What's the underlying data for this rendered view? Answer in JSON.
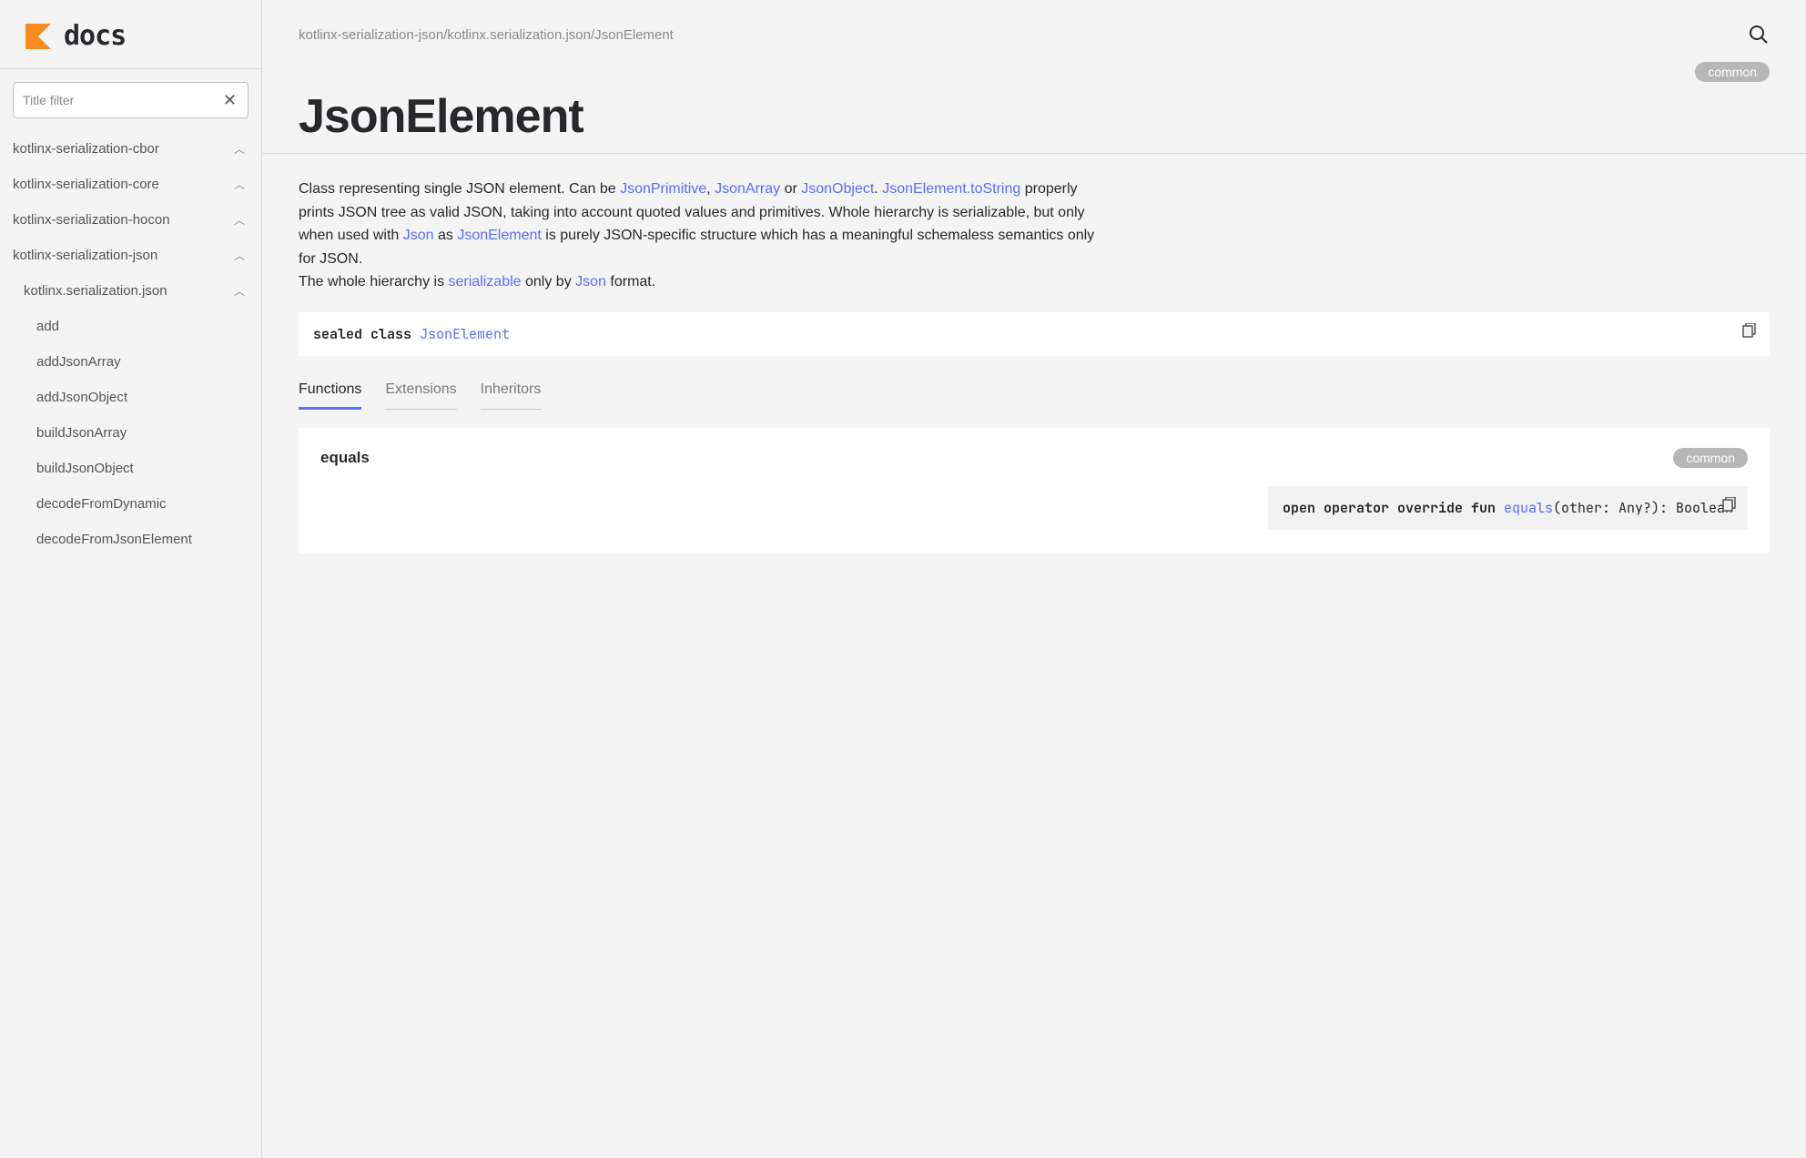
{
  "logo": {
    "text": "docs"
  },
  "filter": {
    "placeholder": "Title filter"
  },
  "nav_top": [
    {
      "label": "kotlinx-serialization-cbor"
    },
    {
      "label": "kotlinx-serialization-core"
    },
    {
      "label": "kotlinx-serialization-hocon"
    },
    {
      "label": "kotlinx-serialization-json"
    }
  ],
  "nav_sub": {
    "label": "kotlinx.serialization.json"
  },
  "nav_leaves": [
    {
      "label": "add"
    },
    {
      "label": "addJsonArray"
    },
    {
      "label": "addJsonObject"
    },
    {
      "label": "buildJsonArray"
    },
    {
      "label": "buildJsonObject"
    },
    {
      "label": "decodeFromDynamic"
    },
    {
      "label": "decodeFromJsonElement"
    }
  ],
  "breadcrumb": "kotlinx-serialization-json/kotlinx.serialization.json/JsonElement",
  "badge": "common",
  "title": "JsonElement",
  "desc": {
    "pre1": "Class representing single JSON element. Can be ",
    "link1": "JsonPrimitive",
    "sep1": ", ",
    "link2": "JsonArray",
    "mid1": " or ",
    "link3": "JsonObject",
    "post1": ". ",
    "link4": "JsonElement.toString",
    "post2": " properly prints JSON tree as valid JSON, taking into account quoted values and primitives. Whole hierarchy is serializable, but only when used with ",
    "link5": "Json",
    "post3": " as ",
    "link6": "JsonElement",
    "post4": " is purely JSON-specific structure which has a meaningful schemaless semantics only for JSON.",
    "line2_pre": "The whole hierarchy is ",
    "line2_link1": "serializable",
    "line2_mid": " only by ",
    "line2_link2": "Json",
    "line2_post": " format."
  },
  "signature": {
    "prefix": "sealed class ",
    "type": "JsonElement"
  },
  "tabs": [
    {
      "label": "Functions"
    },
    {
      "label": "Extensions"
    },
    {
      "label": "Inheritors"
    }
  ],
  "card": {
    "title": "equals",
    "badge": "common",
    "sig_prefix": "open operator override fun ",
    "sig_link": "equals",
    "sig_suffix": "(other: Any?): Boolean"
  }
}
